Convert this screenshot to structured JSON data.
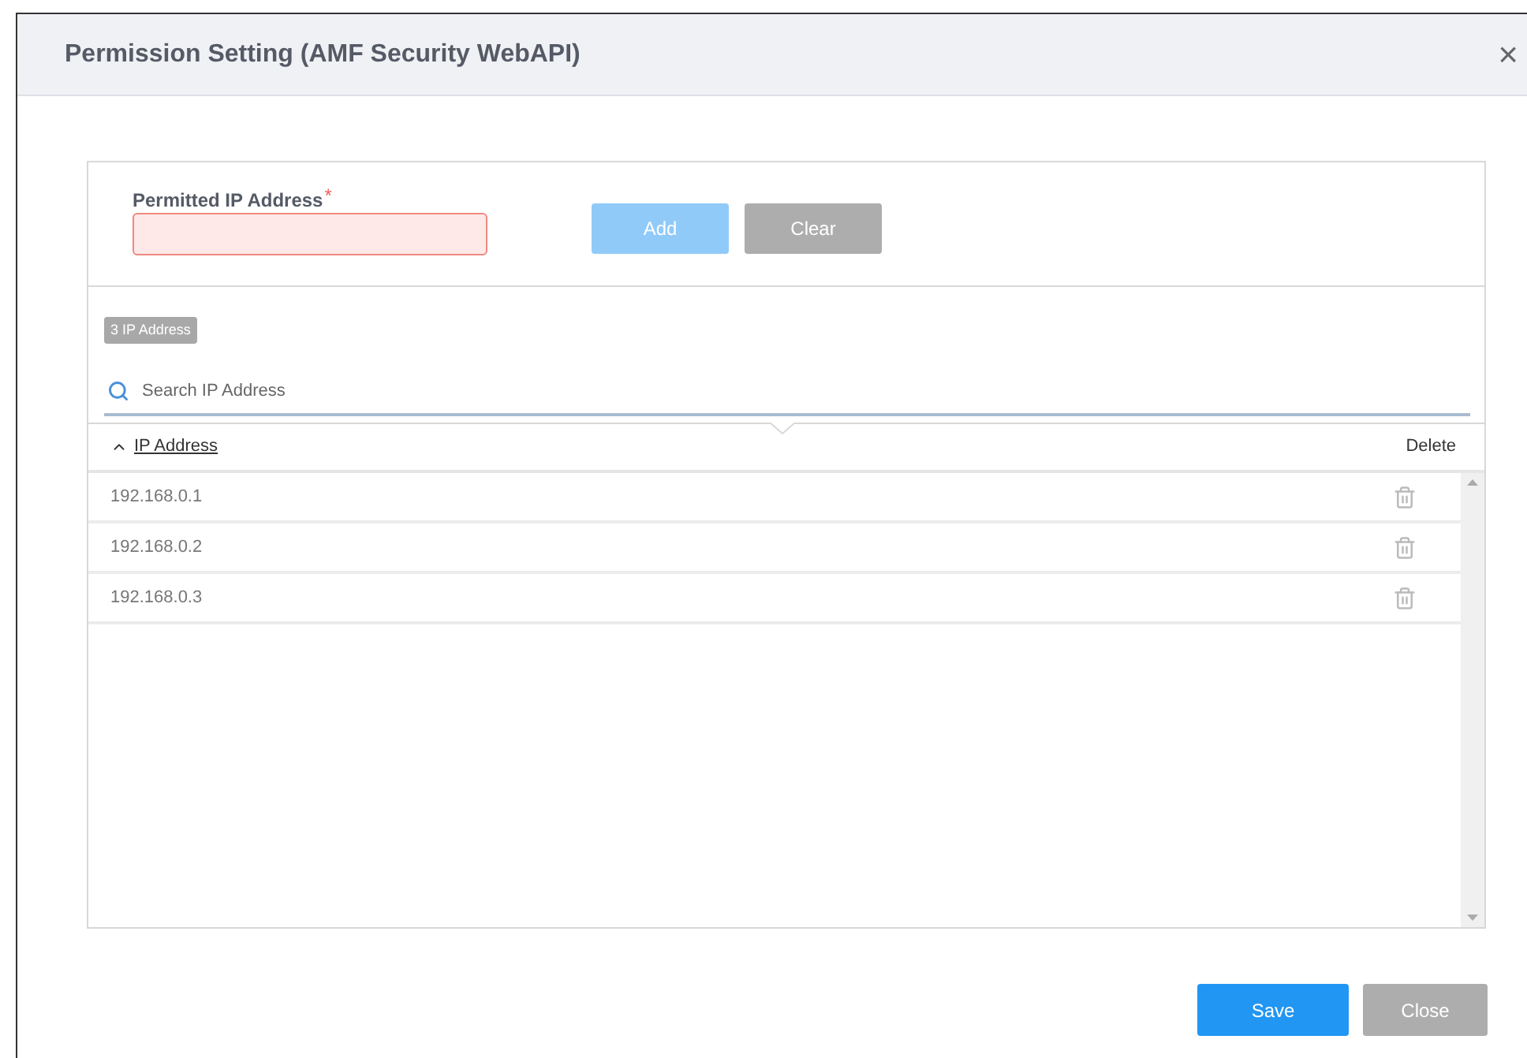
{
  "dialog": {
    "title": "Permission Setting (AMF Security WebAPI)",
    "close_icon": "×"
  },
  "form": {
    "label": "Permitted IP Address",
    "required_mark": "*",
    "error": true
  },
  "form_buttons": [
    {
      "label": "Add",
      "kind": "primary",
      "disabled": true
    },
    {
      "label": "Clear",
      "kind": "secondary",
      "disabled": false
    }
  ],
  "count_badge": "3 IP Address",
  "search": {
    "placeholder": "Search IP Address"
  },
  "table": {
    "columns": [
      {
        "label": "IP Address",
        "sorted_ascending": true
      },
      {
        "label": "Delete"
      }
    ],
    "rows": [
      {
        "ip": "192.168.0.1"
      },
      {
        "ip": "192.168.0.2"
      },
      {
        "ip": "192.168.0.3"
      }
    ]
  },
  "footer_buttons": [
    {
      "label": "Save",
      "kind": "primary",
      "disabled": false
    },
    {
      "label": "Close",
      "kind": "secondary",
      "disabled": false
    }
  ]
}
